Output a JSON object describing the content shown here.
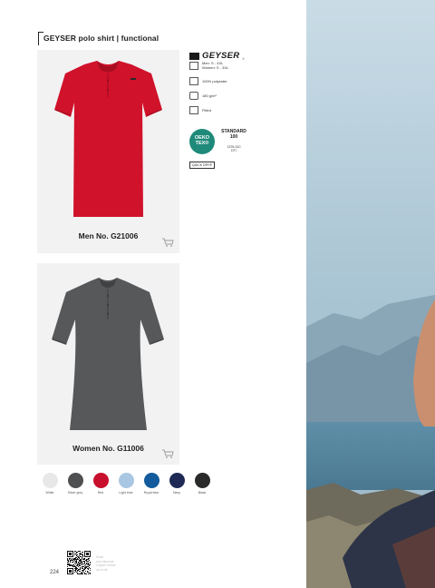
{
  "header": {
    "title": "GEYSER polo shirt | functional"
  },
  "products": [
    {
      "label": "Men No. G21006",
      "color": "#d0122b"
    },
    {
      "label": "Women No. G11006",
      "color": "#56585a"
    }
  ],
  "brand": {
    "logo_text": "GEYSER",
    "trademark": "®"
  },
  "specs": {
    "sizes_men": "Men: S - 4XL",
    "sizes_women": "Women: S - 3XL",
    "material": "100% polyester",
    "weight": "180 g/m²",
    "fit": "Fitted"
  },
  "certification": {
    "oeko_line1": "OEKO",
    "oeko_line2": "TEX®",
    "standard_line1": "STANDARD",
    "standard_line2": "100",
    "code_line1": "1376-310",
    "code_line2": "DTI"
  },
  "badge": "QUICK DRY®",
  "colors": [
    {
      "name": "White",
      "hex": "#e8e8e8"
    },
    {
      "name": "Silver grey",
      "hex": "#4e4f51"
    },
    {
      "name": "Red",
      "hex": "#c8102e"
    },
    {
      "name": "Light blue",
      "hex": "#a9c6e2"
    },
    {
      "name": "Royal blue",
      "hex": "#135b9c"
    },
    {
      "name": "Navy",
      "hex": "#1e2a55"
    },
    {
      "name": "Black",
      "hex": "#2a2a2a"
    }
  ],
  "footer": {
    "qr_caption_1": "Scan",
    "qr_caption_2": "and discover",
    "qr_caption_3": "Geyser online",
    "qr_caption_4": "on-in.dk",
    "page_number": "224"
  }
}
